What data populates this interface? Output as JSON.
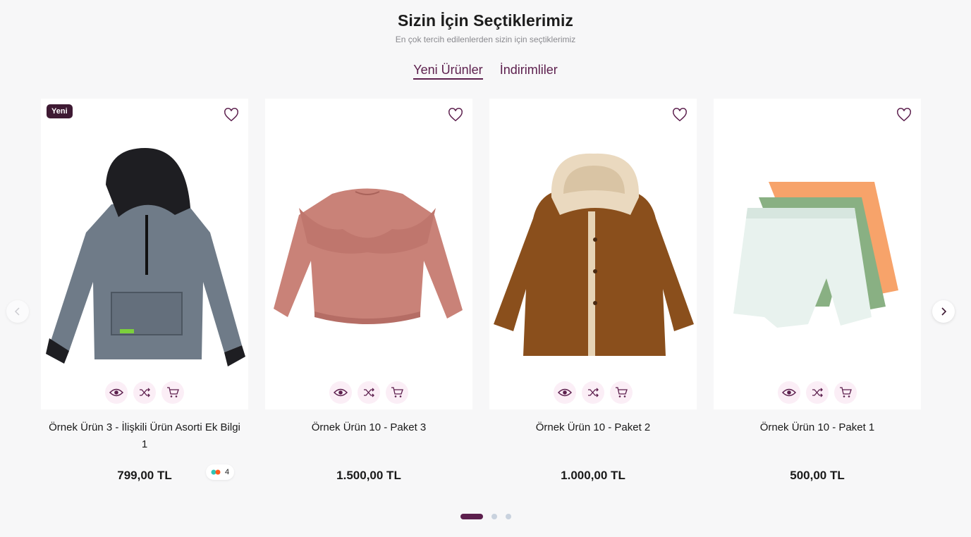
{
  "header": {
    "title": "Sizin İçin Seçtiklerimiz",
    "subtitle": "En çok tercih edilenlerden sizin için seçtiklerimiz"
  },
  "tabs": [
    {
      "label": "Yeni Ürünler",
      "active": true
    },
    {
      "label": "İndirimliler",
      "active": false
    }
  ],
  "products": [
    {
      "name": "Örnek Ürün 3 - İlişkili Ürün Asorti Ek Bilgi 1",
      "price": "799,00 TL",
      "badge": "Yeni",
      "variant_count": "4",
      "image": "grey-hoodie"
    },
    {
      "name": "Örnek Ürün 10 - Paket 3",
      "price": "1.500,00 TL",
      "image": "pink-ruffle-sweatshirt"
    },
    {
      "name": "Örnek Ürün 10 - Paket 2",
      "price": "1.000,00 TL",
      "image": "brown-fur-coat"
    },
    {
      "name": "Örnek Ürün 10 - Paket 1",
      "price": "500,00 TL",
      "image": "shorts-set"
    }
  ],
  "pagination": {
    "pages": 3,
    "current": 1
  },
  "colors": {
    "accent": "#5c1f4d",
    "badge": "#3e1a33",
    "action_bg": "#fbeef6"
  }
}
